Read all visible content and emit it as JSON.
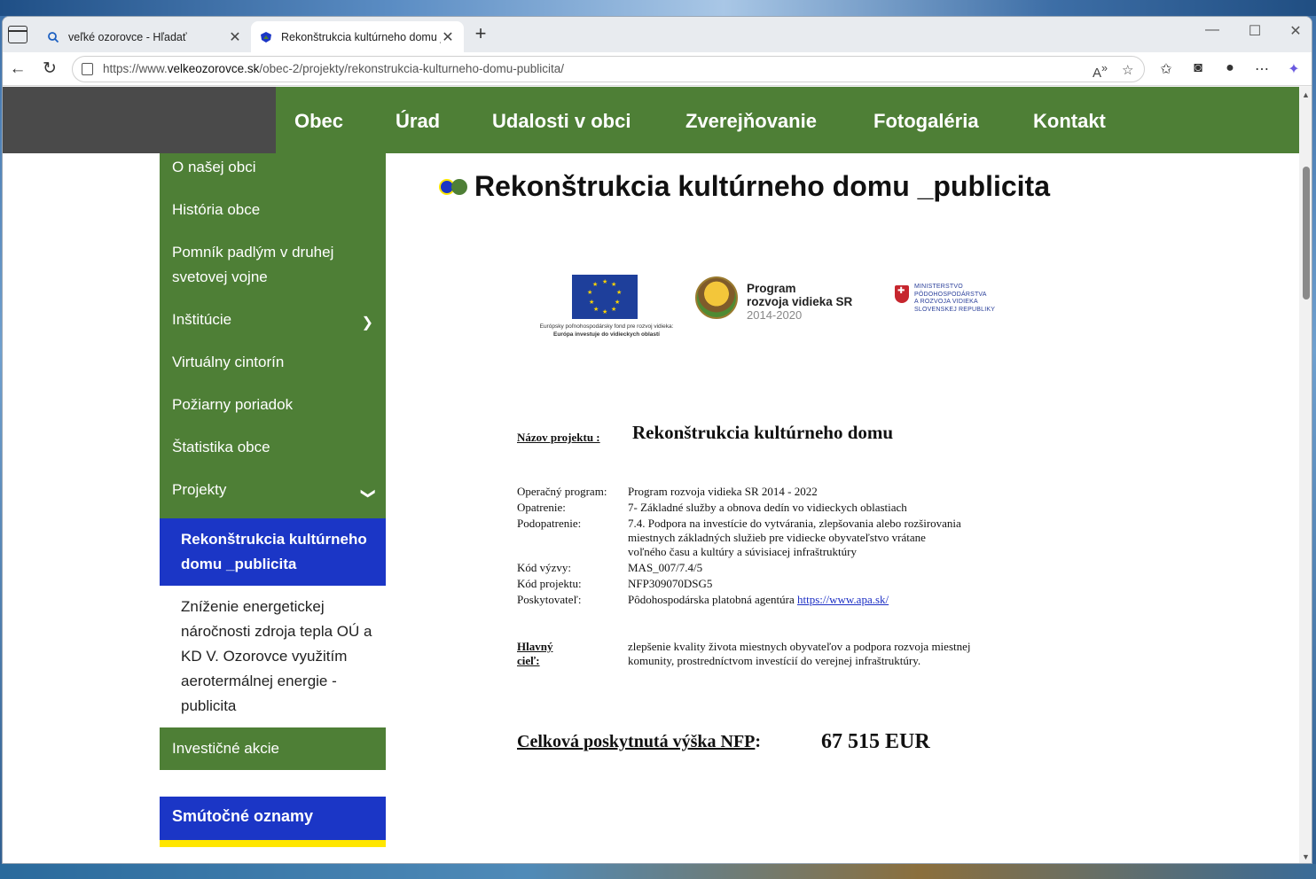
{
  "browser": {
    "tabs": [
      {
        "title": "veľké ozorovce - Hľadať",
        "active": false
      },
      {
        "title": "Rekonštrukcia kultúrneho domu _",
        "active": true
      }
    ],
    "url_prefix": "https://www.",
    "url_domain": "velkeozorovce.sk",
    "url_path": "/obec-2/projekty/rekonstrukcia-kulturneho-domu-publicita/"
  },
  "site": {
    "colors": {
      "green": "#4e7f36",
      "blue": "#1b36c6",
      "yellow": "#ffe600",
      "dark": "#4a4a4a"
    },
    "nav": [
      "Obec",
      "Úrad",
      "Udalosti v obci",
      "Zverejňovanie",
      "Fotogaléria",
      "Kontakt"
    ],
    "sidebar": {
      "items": [
        {
          "label": "O našej obci"
        },
        {
          "label": "História obce"
        },
        {
          "label": "Pomník padlým v druhej svetovej vojne"
        },
        {
          "label": "Inštitúcie"
        },
        {
          "label": "Virtuálny cintorín"
        },
        {
          "label": "Požiarny poriadok"
        },
        {
          "label": "Štatistika obce"
        },
        {
          "label": "Projekty"
        }
      ],
      "sub_active": "Rekonštrukcia kultúrneho domu _publicita",
      "sub_other": "Zníženie energetickej náročnosti zdroja tepla OÚ a KD V. Ozorovce využitím aerotermálnej energie - publicita",
      "after": "Investičné akcie",
      "box": "Smútočné oznamy"
    },
    "title": "Rekonštrukcia kultúrneho domu _publicita"
  },
  "logos": {
    "eu_caption_1": "Európsky poľnohospodársky fond pre rozvoj vidieka:",
    "eu_caption_2": "Európa investuje do vidieckych oblastí",
    "prv_line1": "Program",
    "prv_line2": "rozvoja vidieka SR",
    "prv_years": "2014-2020",
    "min_1": "MINISTERSTVO",
    "min_2": "PÔDOHOSPODÁRSTVA",
    "min_3": "A ROZVOJA VIDIEKA",
    "min_4": "SLOVENSKEJ REPUBLIKY"
  },
  "doc": {
    "project_label": "Názov projektu :",
    "project_name": "Rekonštrukcia  kultúrneho domu",
    "rows": [
      {
        "k": "Operačný program:",
        "v": "Program rozvoja vidieka SR 2014 - 2022"
      },
      {
        "k": "Opatrenie:",
        "v": "7- Základné služby a obnova dedín vo vidieckych oblastiach"
      },
      {
        "k": "Podopatrenie:",
        "v": "7.4. Podpora na investície do vytvárania, zlepšovania alebo rozširovania"
      },
      {
        "k": "",
        "v": "miestnych základných služieb pre vidiecke obyvateľstvo vrátane"
      },
      {
        "k": "",
        "v": "voľného času a kultúry a súvisiacej infraštruktúry"
      },
      {
        "k": "Kód výzvy:",
        "v": "MAS_007/7.4/5"
      },
      {
        "k": "Kód projektu:",
        "v": "NFP309070DSG5"
      },
      {
        "k": "Poskytovateľ:",
        "v": "Pôdohospodárska platobná agentúra "
      }
    ],
    "provider_link": "https://www.apa.sk/",
    "goal_label": "Hlavný cieľ:",
    "goal_text": "zlepšenie kvality života miestnych obyvateľov a podpora rozvoja miestnej komunity, prostredníctvom investícií do verejnej infraštruktúry.",
    "total_label": "Celková poskytnutá výška NFP",
    "total_colon": ":",
    "total_amount": "67 515 EUR"
  }
}
